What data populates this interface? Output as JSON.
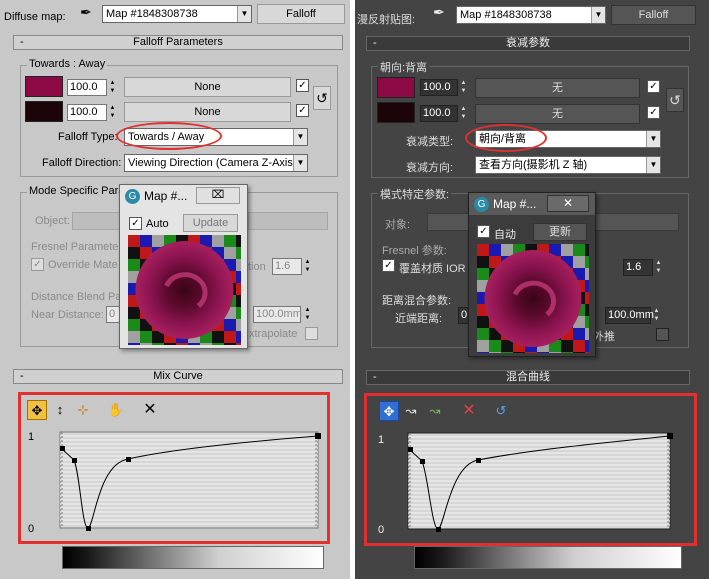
{
  "left": {
    "top_label": "Diffuse map:",
    "map_name": "Map #1848308738",
    "falloff_button": "Falloff",
    "params_title": "Falloff Parameters",
    "towards_away_title": "Towards : Away",
    "value1": "100.0",
    "value2": "100.0",
    "none1": "None",
    "none2": "None",
    "falloff_type_label": "Falloff Type:",
    "falloff_type_value": "Towards / Away",
    "falloff_dir_label": "Falloff Direction:",
    "falloff_dir_value": "Viewing Direction (Camera Z-Axis)",
    "mode_title": "Mode Specific Para",
    "object_label": "Object:",
    "fresnel_label": "Fresnel Parameter",
    "override_label": "Override Mate",
    "tion_label": "tion",
    "ior_value": "1.6",
    "distance_blend_label": "Distance Blend Pa",
    "near_distance_label": "Near Distance:",
    "near_value_partial": "0",
    "far_value": "100.0mm",
    "extrapolate_label": "xtrapolate",
    "mix_curve_title": "Mix Curve",
    "axis_top": "1",
    "axis_bottom": "0",
    "popup": {
      "title": "Map #...",
      "auto": "Auto",
      "update": "Update"
    }
  },
  "right": {
    "top_label": "漫反射贴图:",
    "map_name": "Map #1848308738",
    "falloff_button": "Falloff",
    "params_title": "衰减参数",
    "towards_away_title": "朝向:背离",
    "value1": "100.0",
    "value2": "100.0",
    "none1": "无",
    "none2": "无",
    "falloff_type_label": "衰减类型:",
    "falloff_type_value": "朝向/背离",
    "falloff_dir_label": "衰减方向:",
    "falloff_dir_value": "查看方向(摄影机 Z 轴)",
    "mode_title": "模式特定参数:",
    "object_label": "对象:",
    "fresnel_label": "Fresnel 参数:",
    "override_label": "覆盖材质 IOR",
    "ior_value": "1.6",
    "distance_blend_label": "距离混合参数:",
    "near_distance_label": "近端距离:",
    "near_value_partial": "0",
    "far_value": "100.0mm",
    "extrapolate_label": "外推",
    "mix_curve_title": "混合曲线",
    "axis_top": "1",
    "axis_bottom": "0",
    "popup": {
      "title": "Map #...",
      "auto": "自动",
      "update": "更新"
    }
  },
  "colors": {
    "swatch_towards": "#8b0a46",
    "swatch_away": "#1c0508",
    "highlight_red": "#e03030",
    "toolbar_active": "#2f6fd6"
  }
}
